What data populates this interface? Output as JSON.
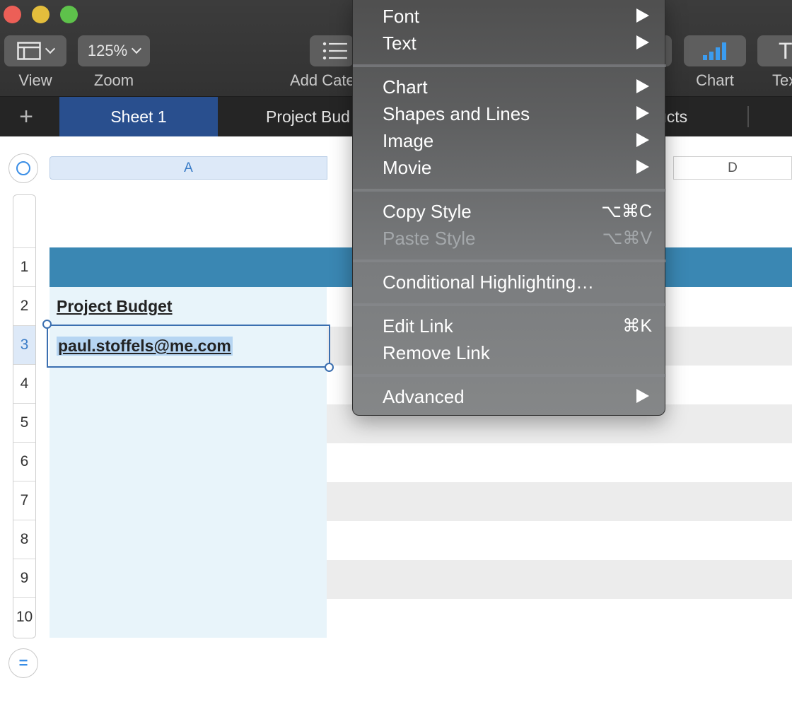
{
  "toolbar": {
    "view_label": "View",
    "zoom_value": "125%",
    "zoom_label": "Zoom",
    "add_category_label": "Add Cate",
    "chart_label": "Chart",
    "text_label": "Tex",
    "text_icon_glyph": "T"
  },
  "tabs": {
    "add_glyph": "+",
    "items": [
      {
        "label": "Sheet 1",
        "active": true
      },
      {
        "label": "Project Bud",
        "active": false
      },
      {
        "label": "ucts",
        "active": false
      }
    ]
  },
  "sheet": {
    "columns": [
      "A",
      "D"
    ],
    "rows": [
      "1",
      "2",
      "3",
      "4",
      "5",
      "6",
      "7",
      "8",
      "9",
      "10"
    ],
    "selected_row": "3",
    "cells": {
      "a2": "Project Budget",
      "a3": "paul.stoffels@me.com"
    },
    "header_color": "#3a87b3",
    "selection_color": "#3b6fb0"
  },
  "context_menu": {
    "items": [
      {
        "label": "Font",
        "submenu": true
      },
      {
        "label": "Text",
        "submenu": true
      },
      {
        "label": "Chart",
        "submenu": true
      },
      {
        "label": "Shapes and Lines",
        "submenu": true
      },
      {
        "label": "Image",
        "submenu": true
      },
      {
        "label": "Movie",
        "submenu": true
      },
      {
        "label": "Copy Style",
        "shortcut": "⌥⌘C"
      },
      {
        "label": "Paste Style",
        "shortcut": "⌥⌘V",
        "disabled": true
      },
      {
        "label": "Conditional Highlighting…"
      },
      {
        "label": "Edit Link",
        "shortcut": "⌘K"
      },
      {
        "label": "Remove Link"
      },
      {
        "label": "Advanced",
        "submenu": true
      }
    ]
  }
}
